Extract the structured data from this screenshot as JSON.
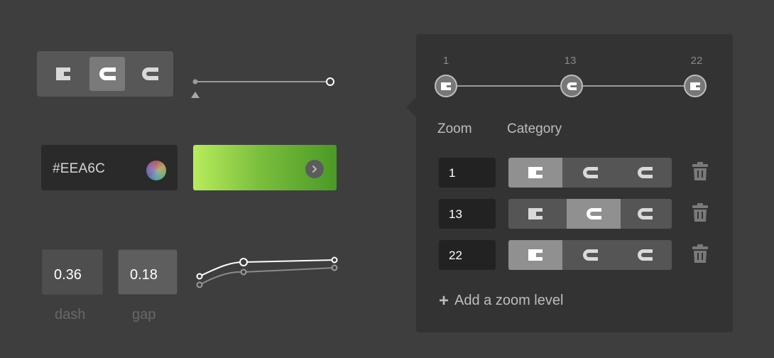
{
  "style": {
    "background": "#3e3e3e",
    "panel": "#333333",
    "active_segment": "#909090",
    "gradient_start": "#b8ec5c",
    "gradient_end": "#4a9a26"
  },
  "cap_selector": {
    "options": [
      "butt-cap-icon",
      "round-cap-icon",
      "square-cap-icon"
    ],
    "selected": 1
  },
  "left_slider": {
    "min_marker": "triangle-marker"
  },
  "color": {
    "hex": "#EEA6C"
  },
  "dash": {
    "value": "0.36",
    "label": "dash"
  },
  "gap": {
    "value": "0.18",
    "label": "gap"
  },
  "zoom_track": {
    "stops": [
      {
        "label": "1",
        "icon": "butt-cap-icon"
      },
      {
        "label": "13",
        "icon": "round-cap-icon"
      },
      {
        "label": "22",
        "icon": "butt-cap-icon"
      }
    ]
  },
  "table": {
    "col_zoom": "Zoom",
    "col_category": "Category",
    "rows": [
      {
        "zoom": "1",
        "selected": 0
      },
      {
        "zoom": "13",
        "selected": 1
      },
      {
        "zoom": "22",
        "selected": 0
      }
    ],
    "category_options": [
      "butt-cap-icon",
      "round-cap-icon",
      "square-cap-icon"
    ]
  },
  "add_label": "Add a zoom level"
}
